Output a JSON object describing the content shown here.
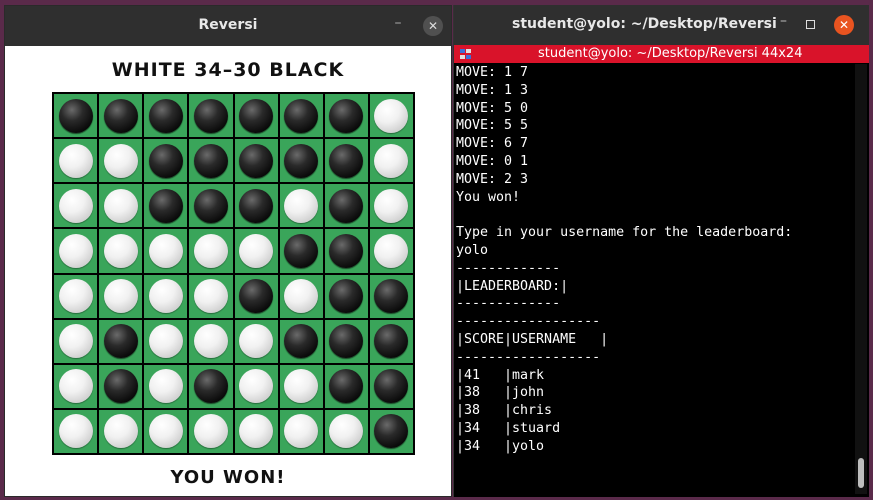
{
  "left_window": {
    "title": "Reversi",
    "minimize": "–",
    "close": "✕",
    "score": "WHITE 34–30 BLACK",
    "result": "YOU WON!",
    "board": [
      [
        "B",
        "B",
        "B",
        "B",
        "B",
        "B",
        "B",
        "W"
      ],
      [
        "W",
        "W",
        "B",
        "B",
        "B",
        "B",
        "B",
        "W"
      ],
      [
        "W",
        "W",
        "B",
        "B",
        "B",
        "W",
        "B",
        "W"
      ],
      [
        "W",
        "W",
        "W",
        "W",
        "W",
        "B",
        "B",
        "W"
      ],
      [
        "W",
        "W",
        "W",
        "W",
        "B",
        "W",
        "B",
        "B"
      ],
      [
        "W",
        "B",
        "W",
        "W",
        "W",
        "B",
        "B",
        "B"
      ],
      [
        "W",
        "B",
        "W",
        "B",
        "W",
        "W",
        "B",
        "B"
      ],
      [
        "W",
        "W",
        "W",
        "W",
        "W",
        "W",
        "W",
        "B"
      ]
    ],
    "colors": {
      "board": "#3aa55a",
      "grid": "#000000"
    }
  },
  "terminal": {
    "window_title": "student@yolo: ~/Desktop/Reversi",
    "tab_title": "student@yolo: ~/Desktop/Reversi 44x24",
    "minimize": "–",
    "close": "✕",
    "lines": [
      "MOVE: 1 7",
      "MOVE: 1 3",
      "MOVE: 5 0",
      "MOVE: 5 5",
      "MOVE: 6 7",
      "MOVE: 0 1",
      "MOVE: 2 3",
      "You won!",
      "",
      "Type in your username for the leaderboard:",
      "yolo",
      "-------------",
      "|LEADERBOARD:|",
      "-------------",
      "------------------",
      "|SCORE|USERNAME   |",
      "------------------",
      "|41   |mark",
      "|38   |john",
      "|38   |chris",
      "|34   |stuard",
      "|34   |yolo"
    ],
    "colors": {
      "tab": "#d9132a",
      "close": "#e95420"
    }
  }
}
